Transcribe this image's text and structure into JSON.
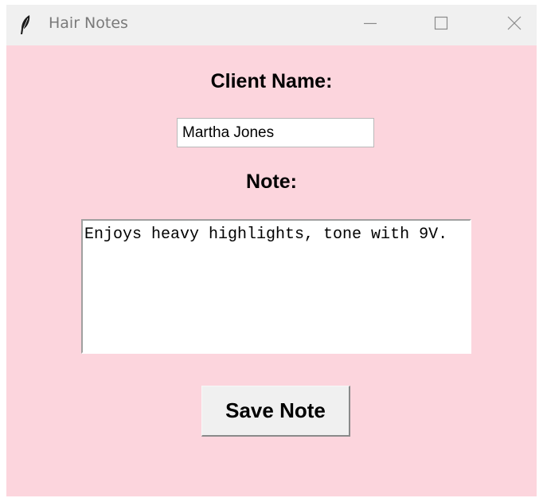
{
  "window": {
    "title": "Hair Notes",
    "icon": "feather-icon",
    "background_color": "#fcd5dd",
    "controls": {
      "minimize_icon": "minimize-icon",
      "maximize_icon": "maximize-icon",
      "close_icon": "close-icon"
    }
  },
  "form": {
    "client_label": "Client Name:",
    "client_value": "Martha Jones",
    "note_label": "Note:",
    "note_value": "Enjoys heavy highlights, tone with 9V.",
    "save_label": "Save Note"
  }
}
